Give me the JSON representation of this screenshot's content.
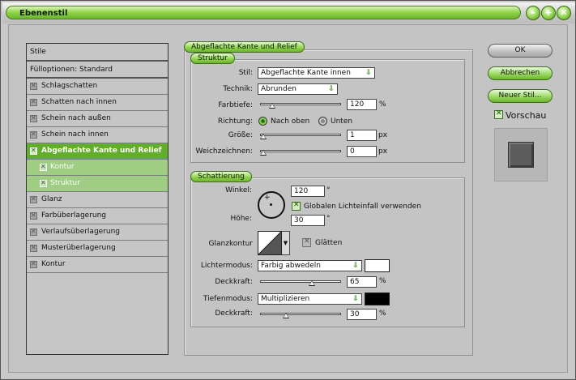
{
  "window": {
    "title": "Ebenenstil",
    "accent": "#6cb42e",
    "controls": [
      "minimize-icon",
      "maximize-icon",
      "close-icon"
    ]
  },
  "sidebar": {
    "header": "Stile",
    "blend": "Fülloptionen: Standard",
    "items": [
      {
        "label": "Schlagschatten",
        "state": "normal"
      },
      {
        "label": "Schatten nach innen",
        "state": "normal"
      },
      {
        "label": "Schein nach außen",
        "state": "normal"
      },
      {
        "label": "Schein nach innen",
        "state": "normal"
      },
      {
        "label": "Abgeflachte Kante und Relief",
        "state": "active"
      },
      {
        "label": "Kontur",
        "state": "sub"
      },
      {
        "label": "Struktur",
        "state": "sub"
      },
      {
        "label": "Glanz",
        "state": "normal"
      },
      {
        "label": "Farbüberlagerung",
        "state": "normal"
      },
      {
        "label": "Verlaufsüberlagerung",
        "state": "normal"
      },
      {
        "label": "Musterüberlagerung",
        "state": "normal"
      },
      {
        "label": "Kontur",
        "state": "normal"
      }
    ]
  },
  "bevel": {
    "section_title": "Abgeflachte Kante und Relief",
    "structure": {
      "title": "Struktur",
      "style_label": "Stil:",
      "style_value": "Abgeflachte Kante innen",
      "technique_label": "Technik:",
      "technique_value": "Abrunden",
      "depth_label": "Farbtiefe:",
      "depth_value": "120",
      "depth_unit": "%",
      "depth_slider": 0.12,
      "direction_label": "Richtung:",
      "direction_up": "Nach oben",
      "direction_down": "Unten",
      "direction_selected": "up",
      "size_label": "Größe:",
      "size_value": "1",
      "size_unit": "px",
      "size_slider": 0.0,
      "soften_label": "Weichzeichnen:",
      "soften_value": "0",
      "soften_unit": "px",
      "soften_slider": 0.0
    },
    "shading": {
      "title": "Schattierung",
      "angle_label": "Winkel:",
      "angle_value": "120",
      "angle_unit": "°",
      "global_light_label": "Globalen Lichteinfall verwenden",
      "global_light_checked": true,
      "altitude_label": "Höhe:",
      "altitude_value": "30",
      "altitude_unit": "°",
      "gloss_label": "Glanzkontur",
      "antialias_label": "Glätten",
      "antialias_checked": false,
      "highlight_mode_label": "Lichtermodus:",
      "highlight_mode_value": "Farbig abwedeln",
      "highlight_color": "#ffffff",
      "highlight_opacity_label": "Deckkraft:",
      "highlight_opacity_value": "65",
      "highlight_opacity_unit": "%",
      "highlight_opacity_slider": 0.65,
      "shadow_mode_label": "Tiefenmodus:",
      "shadow_mode_value": "Multiplizieren",
      "shadow_color": "#000000",
      "shadow_opacity_label": "Deckkraft:",
      "shadow_opacity_value": "30",
      "shadow_opacity_unit": "%",
      "shadow_opacity_slider": 0.3
    }
  },
  "buttons": {
    "ok": "OK",
    "cancel": "Abbrechen",
    "new_style": "Neuer Stil...",
    "preview_label": "Vorschau",
    "preview_checked": true
  }
}
